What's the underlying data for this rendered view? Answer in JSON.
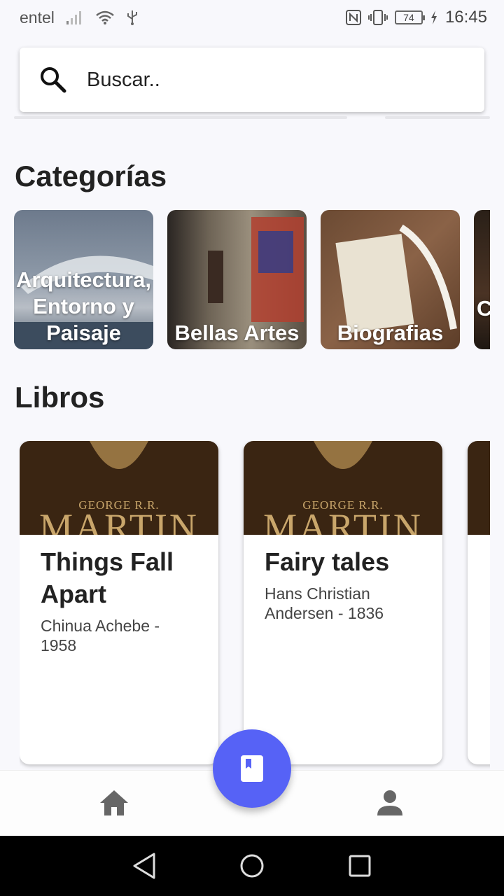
{
  "status_bar": {
    "carrier": "entel",
    "battery": "74",
    "time": "16:45"
  },
  "search": {
    "placeholder": "Buscar.."
  },
  "sections": {
    "categories_title": "Categorías",
    "books_title": "Libros"
  },
  "categories": [
    {
      "label": "Arquitectura, Entorno y Paisaje"
    },
    {
      "label": "Bellas Artes"
    },
    {
      "label": "Biografias"
    },
    {
      "label": "C"
    }
  ],
  "books": [
    {
      "cover_line1": "GEORGE R.R.",
      "cover_line2": "MARTIN",
      "title": "Things Fall Apart",
      "subtitle": "Chinua Achebe - 1958"
    },
    {
      "cover_line1": "GEORGE R.R.",
      "cover_line2": "MARTIN",
      "title": "Fairy tales",
      "subtitle": "Hans Christian Andersen - 1836"
    }
  ],
  "colors": {
    "fab": "#5662f6",
    "background": "#f8f8fc"
  },
  "icons": {
    "search": "search-icon",
    "home": "home-icon",
    "profile": "person-icon",
    "fab": "book-icon"
  }
}
